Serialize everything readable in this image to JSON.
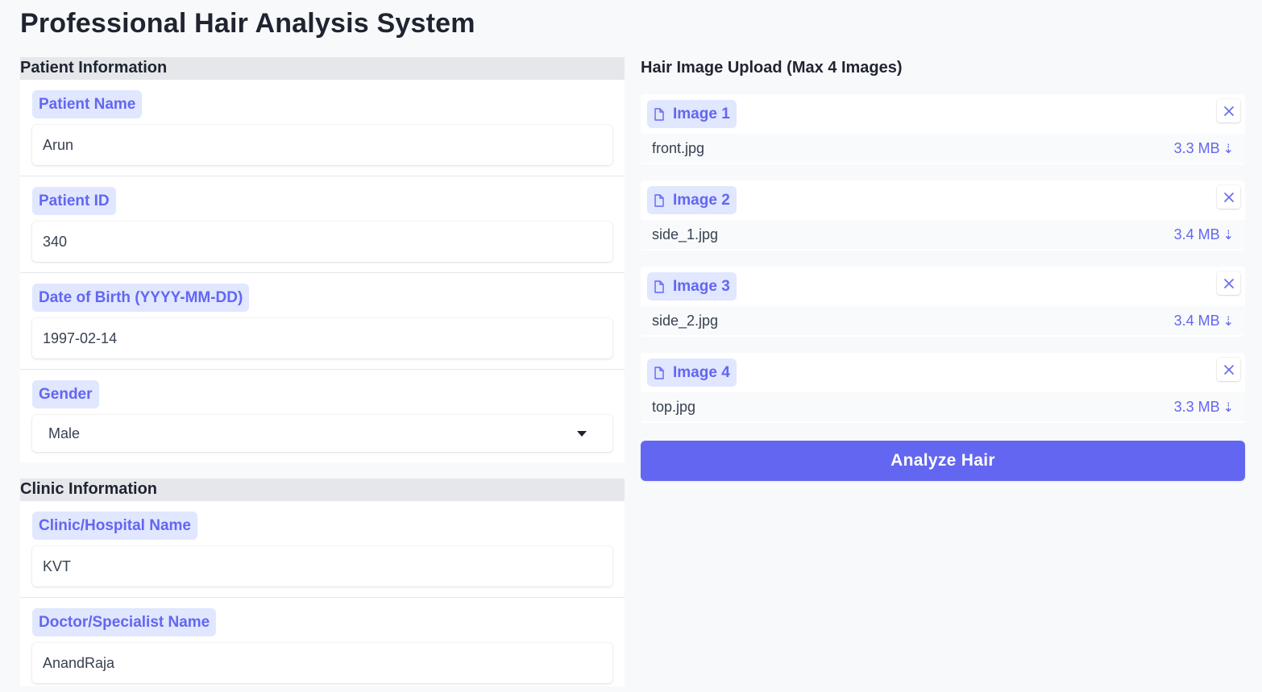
{
  "page": {
    "title": "Professional Hair Analysis System"
  },
  "patient_section": {
    "title": "Patient Information",
    "fields": [
      {
        "label": "Patient Name",
        "value": "Arun"
      },
      {
        "label": "Patient ID",
        "value": "340"
      },
      {
        "label": "Date of Birth (YYYY-MM-DD)",
        "value": "1997-02-14"
      },
      {
        "label": "Gender",
        "value": "Male"
      }
    ]
  },
  "clinic_section": {
    "title": "Clinic Information",
    "fields": [
      {
        "label": "Clinic/Hospital Name",
        "value": "KVT"
      },
      {
        "label": "Doctor/Specialist Name",
        "value": "AnandRaja"
      }
    ]
  },
  "upload": {
    "title": "Hair Image Upload (Max 4 Images)",
    "files": [
      {
        "label": "Image 1",
        "name": "front.jpg",
        "size": "3.3 MB"
      },
      {
        "label": "Image 2",
        "name": "side_1.jpg",
        "size": "3.4 MB"
      },
      {
        "label": "Image 3",
        "name": "side_2.jpg",
        "size": "3.4 MB"
      },
      {
        "label": "Image 4",
        "name": "top.jpg",
        "size": "3.3 MB"
      }
    ],
    "download_glyph": "⇣"
  },
  "actions": {
    "analyze_label": "Analyze Hair"
  },
  "colors": {
    "accent": "#6366f1",
    "label_bg": "#e0e7ff",
    "section_header_bg": "#e5e7eb"
  },
  "icons": {
    "file_tag": "file-icon",
    "remove": "close-icon",
    "download": "download-icon",
    "select": "chevron-down-icon"
  }
}
